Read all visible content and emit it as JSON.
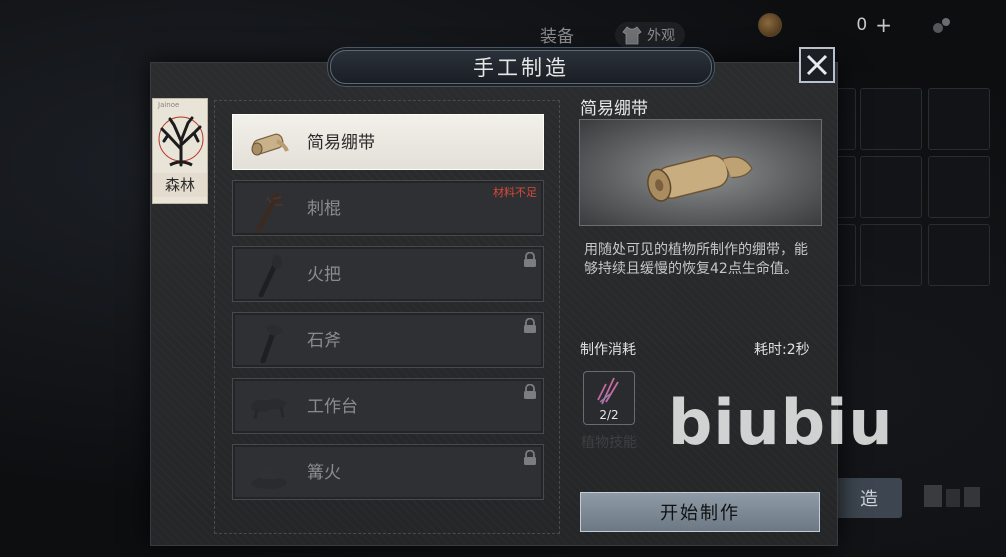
{
  "hud": {
    "gear_tab": "装备",
    "appearance_tab": "外观",
    "coin_count": "0",
    "coin_plus": "+"
  },
  "panel": {
    "title": "手工制造",
    "close_icon": "close-x-icon"
  },
  "biome": {
    "tag": "Jainoe",
    "label": "森林"
  },
  "recipes": [
    {
      "name": "简易绷带",
      "icon": "bandage-icon",
      "selected": true
    },
    {
      "name": "刺棍",
      "icon": "spiked-club-icon",
      "warning": "材料不足"
    },
    {
      "name": "火把",
      "icon": "torch-icon",
      "locked": true
    },
    {
      "name": "石斧",
      "icon": "stone-axe-icon",
      "locked": true
    },
    {
      "name": "工作台",
      "icon": "workbench-icon",
      "locked": true
    },
    {
      "name": "篝火",
      "icon": "campfire-icon",
      "locked": true
    }
  ],
  "detail": {
    "title": "简易绷带",
    "description": "用随处可见的植物所制作的绷带，能够持续且缓慢的恢复42点生命值。",
    "cost_label": "制作消耗",
    "time_label": "耗时:2秒",
    "material_qty": "2/2",
    "faded_text": "植物技能",
    "craft_button": "开始制作"
  },
  "background": {
    "craft_button_partial": "造"
  },
  "watermark": "biubiu",
  "colors": {
    "warning": "#d64a3a",
    "craft_button": "#7d8995",
    "selected_item": "#efece5"
  }
}
